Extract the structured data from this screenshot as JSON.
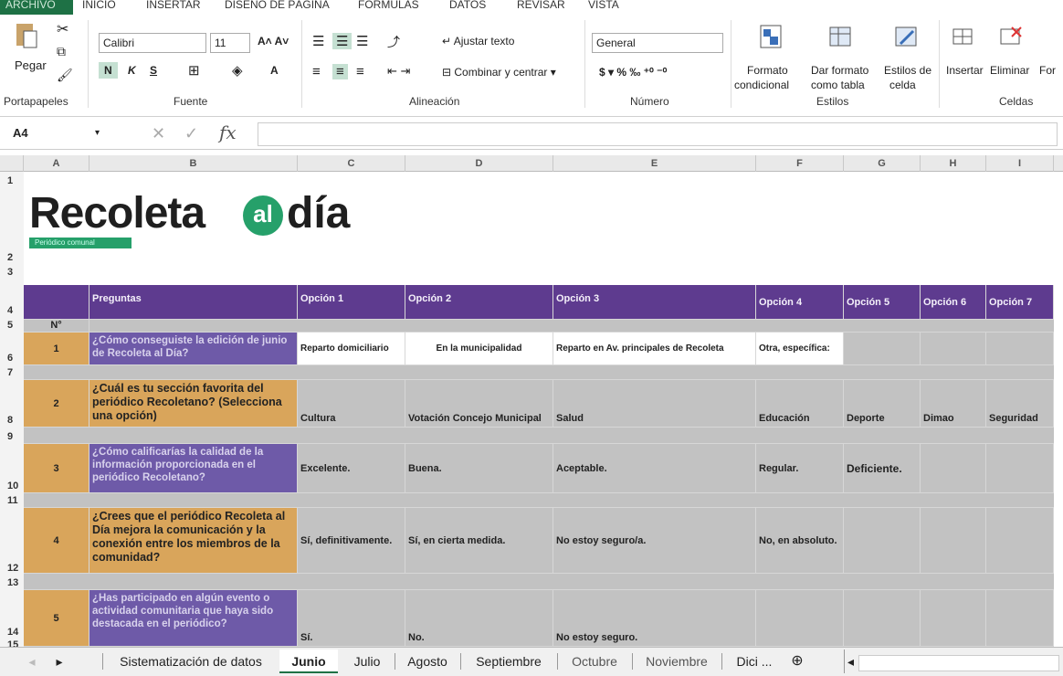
{
  "ribbon": {
    "tabs": [
      "ARCHIVO",
      "INICIO",
      "INSERTAR",
      "DISEÑO DE PÁGINA",
      "FÓRMULAS",
      "DATOS",
      "REVISAR",
      "VISTA"
    ],
    "paste_label": "Pegar",
    "font_name": "Calibri",
    "font_size": "11",
    "wrap_text": "Ajustar texto",
    "merge_center": "Combinar y centrar",
    "number_format": "General",
    "conditional_format_l1": "Formato",
    "conditional_format_l2": "condicional",
    "format_table_l1": "Dar formato",
    "format_table_l2": "como tabla",
    "cell_styles_l1": "Estilos de",
    "cell_styles_l2": "celda",
    "insert_label": "Insertar",
    "delete_label": "Eliminar",
    "format_label": "For",
    "groups": {
      "clipboard": "Portapapeles",
      "font": "Fuente",
      "alignment": "Alineación",
      "number": "Número",
      "styles": "Estilos",
      "cells": "Celdas"
    }
  },
  "formula_bar": {
    "name_box": "A4",
    "fx": "fx",
    "value": ""
  },
  "columns": [
    "A",
    "B",
    "C",
    "D",
    "E",
    "F",
    "G",
    "H",
    "I"
  ],
  "rows": [
    "1",
    "2",
    "3",
    "4",
    "5",
    "6",
    "7",
    "8",
    "9",
    "10",
    "11",
    "12",
    "13",
    "14",
    "15"
  ],
  "logo": {
    "part1": "Recoleta",
    "part2": "al",
    "part3": "día",
    "tagline": "Periódico comunal"
  },
  "header": {
    "preguntas": "Preguntas",
    "options": [
      "Opción 1",
      "Opción 2",
      "Opción 3",
      "Opción 4",
      "Opción 5",
      "Opción 6",
      "Opción 7"
    ],
    "n": "N°"
  },
  "questions": [
    {
      "n": "1",
      "q": "¿Cómo conseguiste la edición de junio de Recoleta al Día?",
      "opts": [
        "Reparto domiciliario",
        "En la municipalidad",
        "Reparto en Av. principales de Recoleta",
        "Otra, específica:",
        "",
        "",
        ""
      ]
    },
    {
      "n": "2",
      "q": "¿Cuál es tu sección favorita del periódico Recoletano? (Selecciona una opción)",
      "opts": [
        "Cultura",
        "Votación Concejo Municipal",
        "Salud",
        "Educación",
        "Deporte",
        "Dimao",
        "Seguridad"
      ]
    },
    {
      "n": "3",
      "q": "¿Cómo calificarías la calidad de la información proporcionada en el periódico Recoletano?",
      "opts": [
        "Excelente.",
        "Buena.",
        "Aceptable.",
        "Regular.",
        "Deficiente.",
        "",
        ""
      ]
    },
    {
      "n": "4",
      "q": "¿Crees que el periódico Recoleta al Día mejora la comunicación y la conexión entre los miembros de la comunidad?",
      "opts": [
        "Sí, definitivamente.",
        "Sí, en cierta medida.",
        "No estoy seguro/a.",
        "No, en absoluto.",
        "",
        "",
        ""
      ]
    },
    {
      "n": "5",
      "q": "¿Has participado en algún evento o actividad comunitaria que haya sido destacada en el periódico?",
      "opts": [
        "Sí.",
        "No.",
        "No estoy seguro.",
        "",
        "",
        "",
        ""
      ]
    }
  ],
  "sheet_tabs": [
    "Sistematización de datos",
    "Junio",
    "Julio",
    "Agosto",
    "Septiembre",
    "Octubre",
    "Noviembre",
    "Dici ..."
  ],
  "active_sheet": "Junio",
  "colors": {
    "header_purple": "#5e3b8f",
    "number_orange": "#d9a55b",
    "question_purple": "#6e5aa8",
    "excel_green": "#1e7145"
  }
}
